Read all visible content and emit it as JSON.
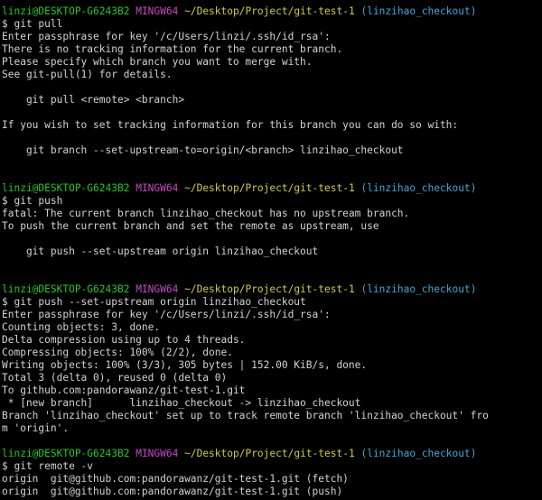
{
  "colors": {
    "background": "#000000",
    "text": "#d3d3d3",
    "prompt_user": "#21c921",
    "prompt_system": "#c846c8",
    "prompt_path": "#cfcc3b",
    "prompt_branch": "#3fa7d6"
  },
  "prompt": {
    "user_host": "linzi@DESKTOP-G6243B2",
    "system": "MINGW64",
    "path": "~/Desktop/Project/git-test-1",
    "branch": "(linzihao_checkout)"
  },
  "session": [
    {
      "type": "prompt"
    },
    {
      "type": "text",
      "text": "$ git pull"
    },
    {
      "type": "text",
      "text": "Enter passphrase for key '/c/Users/linzi/.ssh/id_rsa':"
    },
    {
      "type": "text",
      "text": "There is no tracking information for the current branch."
    },
    {
      "type": "text",
      "text": "Please specify which branch you want to merge with."
    },
    {
      "type": "text",
      "text": "See git-pull(1) for details."
    },
    {
      "type": "text",
      "text": ""
    },
    {
      "type": "text",
      "text": "    git pull <remote> <branch>"
    },
    {
      "type": "text",
      "text": ""
    },
    {
      "type": "text",
      "text": "If you wish to set tracking information for this branch you can do so with:"
    },
    {
      "type": "text",
      "text": ""
    },
    {
      "type": "text",
      "text": "    git branch --set-upstream-to=origin/<branch> linzihao_checkout"
    },
    {
      "type": "text",
      "text": ""
    },
    {
      "type": "text",
      "text": ""
    },
    {
      "type": "prompt"
    },
    {
      "type": "text",
      "text": "$ git push"
    },
    {
      "type": "text",
      "text": "fatal: The current branch linzihao_checkout has no upstream branch."
    },
    {
      "type": "text",
      "text": "To push the current branch and set the remote as upstream, use"
    },
    {
      "type": "text",
      "text": ""
    },
    {
      "type": "text",
      "text": "    git push --set-upstream origin linzihao_checkout"
    },
    {
      "type": "text",
      "text": ""
    },
    {
      "type": "text",
      "text": ""
    },
    {
      "type": "prompt"
    },
    {
      "type": "text",
      "text": "$ git push --set-upstream origin linzihao_checkout"
    },
    {
      "type": "text",
      "text": "Enter passphrase for key '/c/Users/linzi/.ssh/id_rsa':"
    },
    {
      "type": "text",
      "text": "Counting objects: 3, done."
    },
    {
      "type": "text",
      "text": "Delta compression using up to 4 threads."
    },
    {
      "type": "text",
      "text": "Compressing objects: 100% (2/2), done."
    },
    {
      "type": "text",
      "text": "Writing objects: 100% (3/3), 305 bytes | 152.00 KiB/s, done."
    },
    {
      "type": "text",
      "text": "Total 3 (delta 0), reused 0 (delta 0)"
    },
    {
      "type": "text",
      "text": "To github.com:pandorawanz/git-test-1.git"
    },
    {
      "type": "text",
      "text": " * [new branch]      linzihao_checkout -> linzihao_checkout"
    },
    {
      "type": "text",
      "text": "Branch 'linzihao_checkout' set up to track remote branch 'linzihao_checkout' fro"
    },
    {
      "type": "text",
      "text": "m 'origin'."
    },
    {
      "type": "text",
      "text": ""
    },
    {
      "type": "prompt"
    },
    {
      "type": "text",
      "text": "$ git remote -v"
    },
    {
      "type": "text",
      "text": "origin  git@github.com:pandorawanz/git-test-1.git (fetch)"
    },
    {
      "type": "text",
      "text": "origin  git@github.com:pandorawanz/git-test-1.git (push)"
    }
  ]
}
